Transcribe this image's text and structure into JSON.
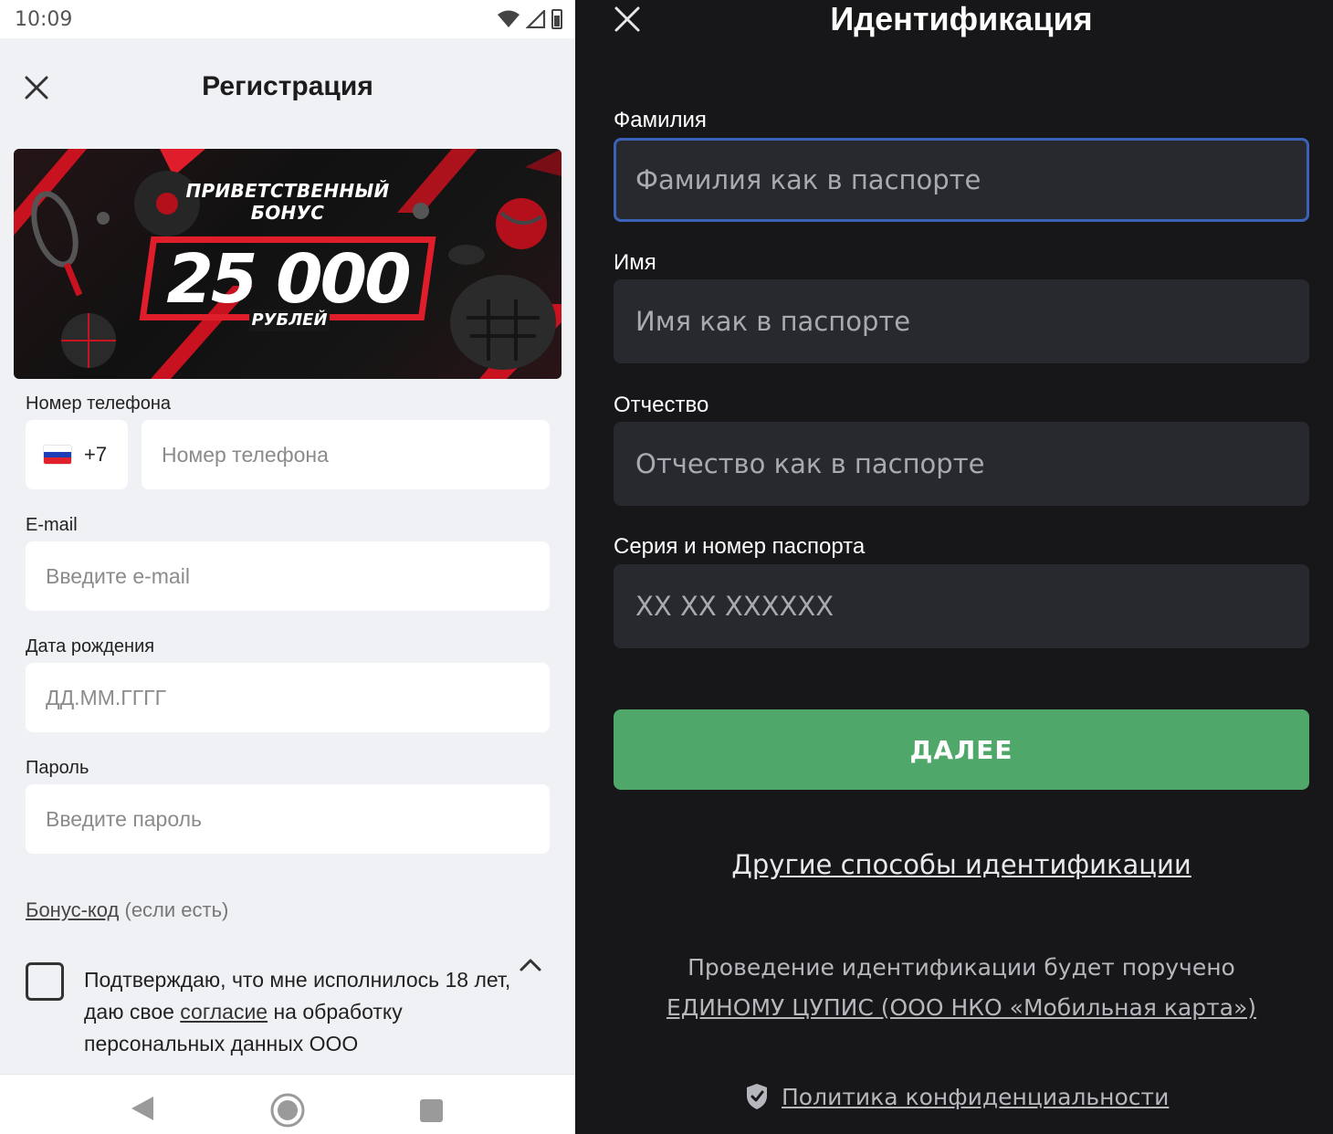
{
  "status_bar": {
    "time": "10:09"
  },
  "registration": {
    "title": "Регистрация",
    "banner": {
      "headline_line1": "ПРИВЕТСТВЕННЫЙ",
      "headline_line2": "БОНУС",
      "amount": "25 000",
      "currency": "РУБЛЕЙ"
    },
    "phone": {
      "label": "Номер телефона",
      "country_code": "+7",
      "placeholder": "Номер телефона"
    },
    "email": {
      "label": "E-mail",
      "placeholder": "Введите e-mail"
    },
    "birthdate": {
      "label": "Дата рождения",
      "placeholder": "ДД.ММ.ГГГГ"
    },
    "password": {
      "label": "Пароль",
      "placeholder": "Введите пароль"
    },
    "bonus_code": {
      "link": "Бонус-код",
      "note": " (если есть)"
    },
    "consent": {
      "before_link": "Подтверждаю, что мне исполнилось 18 лет, даю свое ",
      "link": "согласие",
      "after_link": " на обработку персональных данных ООО"
    },
    "colors": {
      "background": "#f0f1f4",
      "accent_red": "#e01d2a",
      "flag_white": "#ffffff",
      "flag_blue": "#1c3fb8",
      "flag_red": "#e2202c"
    }
  },
  "identification": {
    "title": "Идентификация",
    "surname": {
      "label": "Фамилия",
      "placeholder": "Фамилия как в паспорте"
    },
    "name": {
      "label": "Имя",
      "placeholder": "Имя как в паспорте"
    },
    "patronymic": {
      "label": "Отчество",
      "placeholder": "Отчество как в паспорте"
    },
    "passport": {
      "label": "Серия и номер паспорта",
      "placeholder": "XX XX XXXXXX"
    },
    "next_button": "ДАЛЕЕ",
    "other_methods_link": "Другие способы идентификации",
    "notice_text": "Проведение идентификации будет поручено",
    "notice_link": "ЕДИНОМУ ЦУПИС (ООО НКО «Мобильная карта»)",
    "privacy_link": "Политика конфиденциальности",
    "colors": {
      "background": "#17171a",
      "input_bg": "#28292e",
      "focus_border": "#3a63b8",
      "button_green": "#4fa76a"
    }
  }
}
